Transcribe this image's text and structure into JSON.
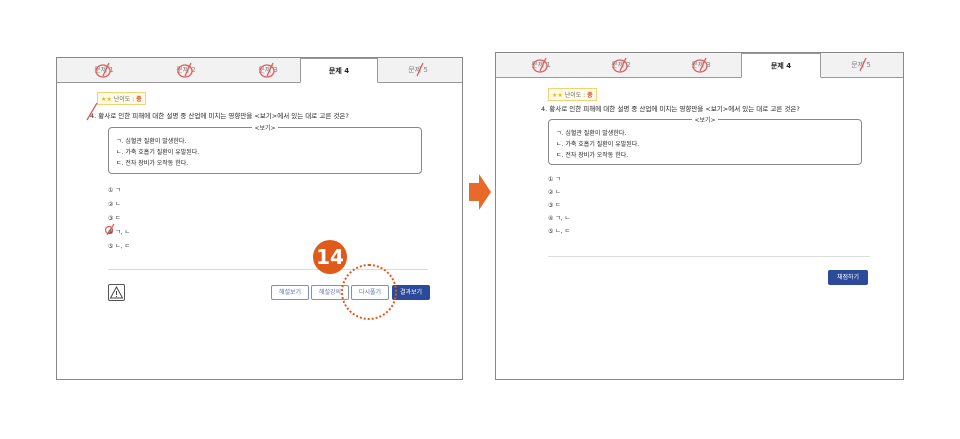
{
  "left_screen": {
    "tabs": [
      "문제 1",
      "문제 2",
      "문제 3",
      "문제 4",
      "문제 5"
    ],
    "active_tab": 3,
    "difficulty": {
      "stars": "★★",
      "label": "난이도 :",
      "level": "중"
    },
    "question": "4. 황사로 인한 피해에 대한 설명 중 산업에 미치는 영향만을 <보기>에서 있는 대로 고른 것은?",
    "bogi": {
      "title": "<보기>",
      "lines": [
        "ㄱ. 심혈관 질환이 발생한다.",
        "ㄴ. 가축 호흡기 질환이 유발된다.",
        "ㄷ. 전자 장비가 오작동 한다."
      ]
    },
    "options": [
      "① ㄱ",
      "② ㄴ",
      "③ ㄷ",
      "④ ㄱ, ㄴ",
      "⑤ ㄴ, ㄷ"
    ],
    "buttons": {
      "explain": "해설보기",
      "lecture": "해설강의",
      "retry": "다시풀기",
      "result": "결과보기"
    },
    "callout_number": "14"
  },
  "right_screen": {
    "tabs": [
      "문제 1",
      "문제 2",
      "문제 3",
      "문제 4",
      "문제 5"
    ],
    "active_tab": 3,
    "difficulty": {
      "stars": "★★",
      "label": "난이도 :",
      "level": "중"
    },
    "question": "4. 황사로 인한 피해에 대한 설명 중 산업에 미치는 영향만을 <보기>에서 있는 대로 고른 것은?",
    "bogi": {
      "title": "<보기>",
      "lines": [
        "ㄱ. 심혈관 질환이 발생한다.",
        "ㄴ. 가축 호흡기 질환이 유발된다.",
        "ㄷ. 전자 장비가 오작동 한다."
      ]
    },
    "options": [
      "① ㄱ",
      "② ㄴ",
      "③ ㄷ",
      "④ ㄱ, ㄴ",
      "⑤ ㄴ, ㄷ"
    ],
    "buttons": {
      "submit": "채점하기"
    }
  },
  "colors": {
    "accent": "#e05a1a",
    "primary_button": "#2c4a9a",
    "mark_red": "#e05a5a"
  }
}
